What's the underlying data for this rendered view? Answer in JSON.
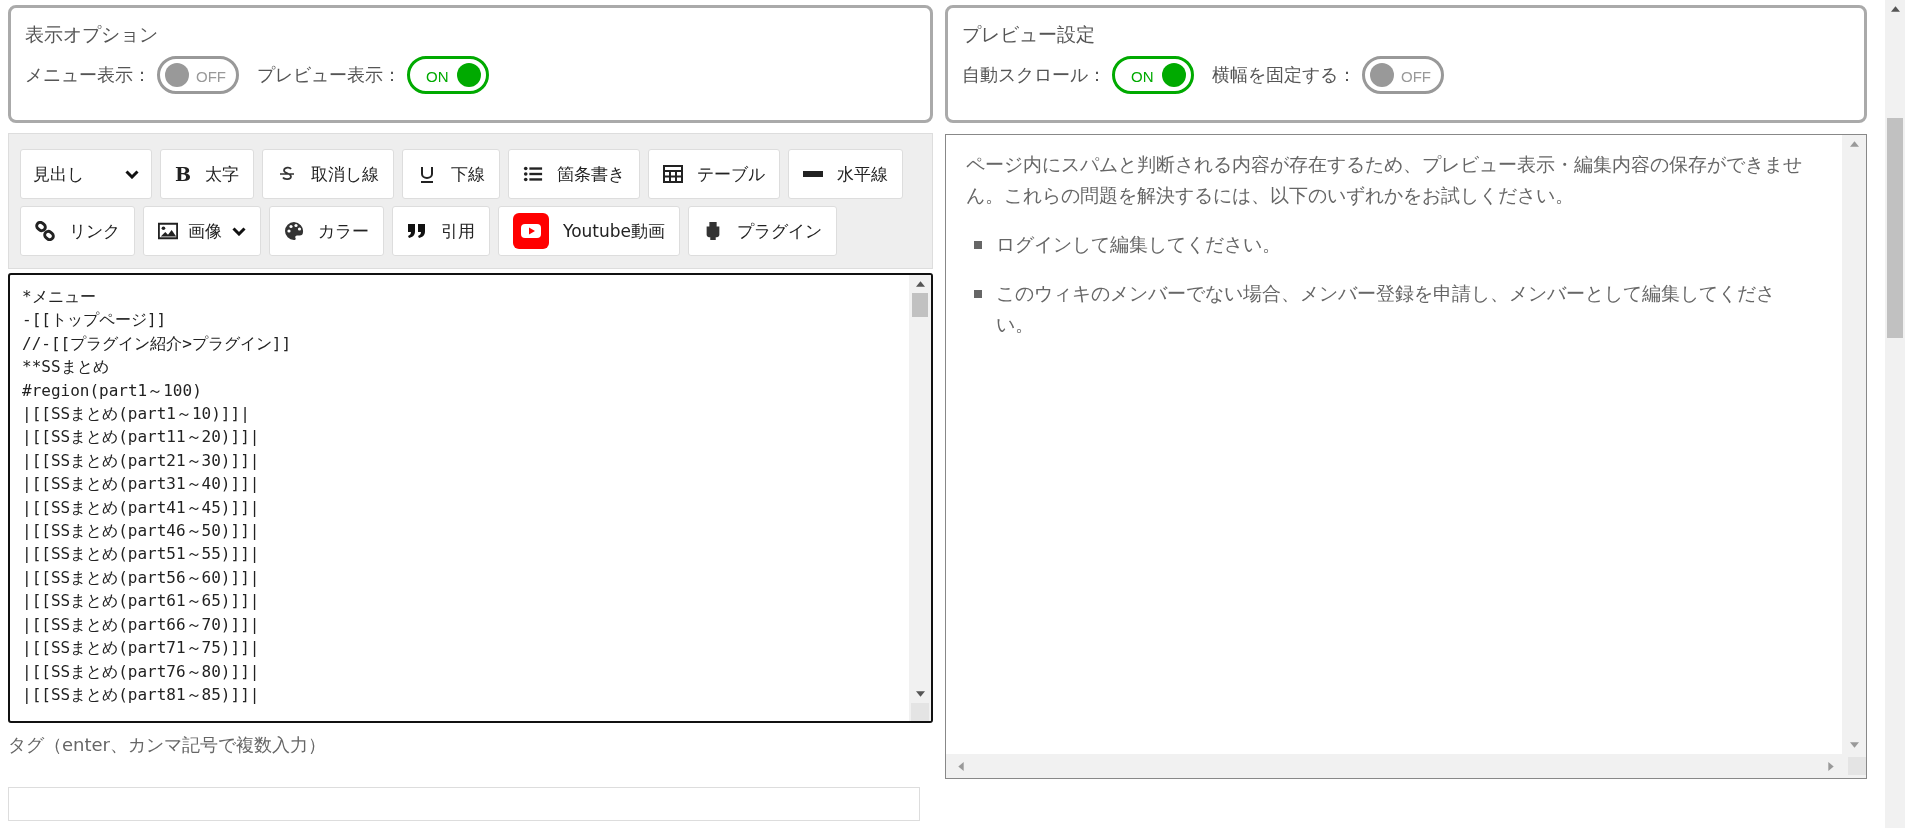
{
  "display_options": {
    "title": "表示オプション",
    "toggles": [
      {
        "label": "メニュー表示：",
        "on": false,
        "state_text": "OFF"
      },
      {
        "label": "プレビュー表示：",
        "on": true,
        "state_text": "ON"
      }
    ]
  },
  "preview_settings": {
    "title": "プレビュー設定",
    "toggles": [
      {
        "label": "自動スクロール：",
        "on": true,
        "state_text": "ON"
      },
      {
        "label": "横幅を固定する：",
        "on": false,
        "state_text": "OFF"
      }
    ]
  },
  "toolbar": {
    "rows": [
      [
        {
          "label": "見出し",
          "kind": "select"
        },
        {
          "label": "太字",
          "kind": "button",
          "glyph": "B"
        },
        {
          "label": "取消し線",
          "kind": "button"
        },
        {
          "label": "下線",
          "kind": "button"
        },
        {
          "label": "箇条書き",
          "kind": "button"
        },
        {
          "label": "テーブル",
          "kind": "button"
        },
        {
          "label": "水平線",
          "kind": "button"
        }
      ],
      [
        {
          "label": "リンク",
          "kind": "button"
        },
        {
          "label": "画像",
          "kind": "menu"
        },
        {
          "label": "カラー",
          "kind": "button"
        },
        {
          "label": "引用",
          "kind": "button"
        },
        {
          "label": "Youtube動画",
          "kind": "button"
        },
        {
          "label": "プラグイン",
          "kind": "button"
        }
      ]
    ]
  },
  "editor": {
    "lines": [
      "*メニュー",
      "-[[トップページ]]",
      "//-[[プラグイン紹介>プラグイン]]",
      "**SSまとめ",
      "#region(part1～100)",
      "|[[SSまとめ(part1～10)]]|",
      "|[[SSまとめ(part11～20)]]|",
      "|[[SSまとめ(part21～30)]]|",
      "|[[SSまとめ(part31～40)]]|",
      "|[[SSまとめ(part41～45)]]|",
      "|[[SSまとめ(part46～50)]]|",
      "|[[SSまとめ(part51～55)]]|",
      "|[[SSまとめ(part56～60)]]|",
      "|[[SSまとめ(part61～65)]]|",
      "|[[SSまとめ(part66～70)]]|",
      "|[[SSまとめ(part71～75)]]|",
      "|[[SSまとめ(part76～80)]]|",
      "|[[SSまとめ(part81～85)]]|"
    ]
  },
  "tags": {
    "label": "タグ（enter、カンマ記号で複数入力）"
  },
  "preview": {
    "message": "ページ内にスパムと判断される内容が存在するため、プレビュー表示・編集内容の保存ができません。これらの問題を解決するには、以下のいずれかをお試しください。",
    "items": [
      "ログインして編集してください。",
      "このウィキのメンバーでない場合、メンバー登録を申請し、メンバーとして編集してください。"
    ]
  }
}
